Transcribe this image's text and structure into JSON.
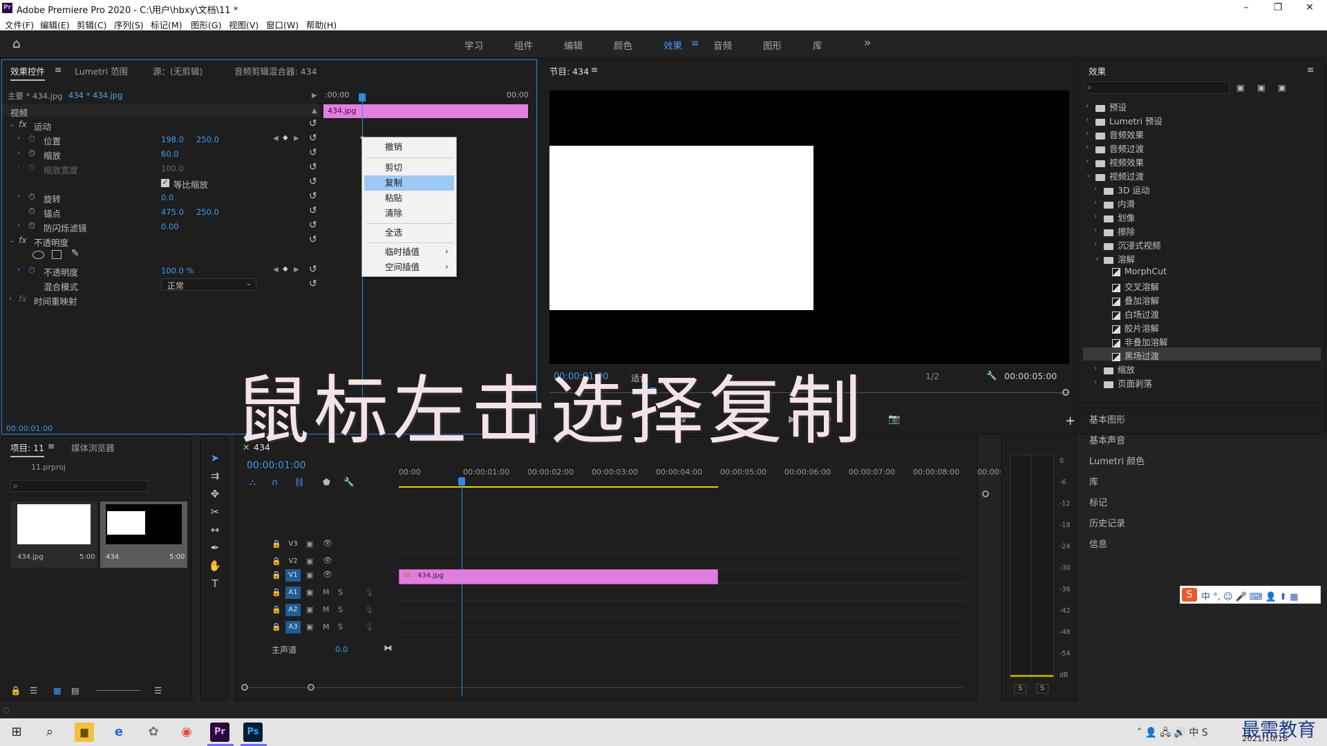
{
  "window": {
    "title": "Adobe Premiere Pro 2020 - C:\\用户\\hbxy\\文档\\11 *",
    "min": "–",
    "max": "❐",
    "close": "✕"
  },
  "menu": [
    "文件(F)",
    "编辑(E)",
    "剪辑(C)",
    "序列(S)",
    "标记(M)",
    "图形(G)",
    "视图(V)",
    "窗口(W)",
    "帮助(H)"
  ],
  "workspaces": {
    "items": [
      "学习",
      "组件",
      "编辑",
      "颜色",
      "效果",
      "音频",
      "图形",
      "库"
    ],
    "active": "效果",
    "more": "»",
    "menu_icon": "≡"
  },
  "effect_controls": {
    "tabs": [
      "效果控件",
      "Lumetri 范围",
      "源：(无剪辑)",
      "音频剪辑混合器: 434"
    ],
    "master": "主要 * 434.jpg",
    "clip": "434 * 434.jpg",
    "ruler_start": ":00:00",
    "ruler_end": "00:00",
    "clip_label": "434.jpg",
    "video_label": "视频",
    "motion": "运动",
    "position": "位置",
    "position_x": "198.0",
    "position_y": "250.0",
    "scale": "缩放",
    "scale_v": "60.0",
    "scale_width": "缩放宽度",
    "scale_width_v": "100.0",
    "uniform": "等比缩放",
    "rotation": "旋转",
    "rotation_v": "0.0",
    "anchor": "锚点",
    "anchor_x": "475.0",
    "anchor_y": "250.0",
    "flicker": "防闪烁滤镜",
    "flicker_v": "0.00",
    "opacity_group": "不透明度",
    "opacity": "不透明度",
    "opacity_v": "100.0 %",
    "blend": "混合模式",
    "blend_v": "正常",
    "remap": "时间重映射",
    "timecode": "00:00:01:00"
  },
  "context_menu": {
    "items": [
      "撤销",
      "剪切",
      "复制",
      "粘贴",
      "清除",
      "全选",
      "临时插值",
      "空间插值"
    ],
    "selected": "复制"
  },
  "program": {
    "title": "节目: 434",
    "timecode": "00:00:01:00",
    "fit": "适合",
    "quality": "1/2",
    "duration": "00:00:05:00"
  },
  "effects_panel": {
    "title": "效果",
    "tree": [
      {
        "label": "预设",
        "type": "folder",
        "level": 0,
        "open": false
      },
      {
        "label": "Lumetri 预设",
        "type": "folder",
        "level": 0,
        "open": false
      },
      {
        "label": "音频效果",
        "type": "folder",
        "level": 0,
        "open": false
      },
      {
        "label": "音频过渡",
        "type": "folder",
        "level": 0,
        "open": false
      },
      {
        "label": "视频效果",
        "type": "folder",
        "level": 0,
        "open": false
      },
      {
        "label": "视频过渡",
        "type": "folder",
        "level": 0,
        "open": true
      },
      {
        "label": "3D 运动",
        "type": "folder",
        "level": 1,
        "open": false
      },
      {
        "label": "内滑",
        "type": "folder",
        "level": 1,
        "open": false
      },
      {
        "label": "划像",
        "type": "folder",
        "level": 1,
        "open": false
      },
      {
        "label": "擦除",
        "type": "folder",
        "level": 1,
        "open": false
      },
      {
        "label": "沉浸式视频",
        "type": "folder",
        "level": 1,
        "open": false
      },
      {
        "label": "溶解",
        "type": "folder",
        "level": 1,
        "open": true
      },
      {
        "label": "MorphCut",
        "type": "fx",
        "level": 2
      },
      {
        "label": "交叉溶解",
        "type": "fx",
        "level": 2
      },
      {
        "label": "叠加溶解",
        "type": "fx",
        "level": 2
      },
      {
        "label": "白场过渡",
        "type": "fx",
        "level": 2
      },
      {
        "label": "胶片溶解",
        "type": "fx",
        "level": 2
      },
      {
        "label": "非叠加溶解",
        "type": "fx",
        "level": 2
      },
      {
        "label": "黑场过渡",
        "type": "fx",
        "level": 2,
        "selected": true
      },
      {
        "label": "缩放",
        "type": "folder",
        "level": 1,
        "open": false
      },
      {
        "label": "页面剥落",
        "type": "folder",
        "level": 1,
        "open": false
      }
    ],
    "links": [
      "基本图形",
      "基本声音",
      "Lumetri 颜色",
      "库",
      "标记",
      "历史记录",
      "信息"
    ]
  },
  "project": {
    "tabs": [
      "项目: 11",
      "媒体浏览器"
    ],
    "file": "11.prproj",
    "items": [
      {
        "name": "434.jpg",
        "dur": "5:00"
      },
      {
        "name": "434",
        "dur": "5:00"
      }
    ]
  },
  "timeline": {
    "tab": "434",
    "timecode": "00:00:01:00",
    "ruler": [
      "00:00",
      "00:00:01:00",
      "00:00:02:00",
      "00:00:03:00",
      "00:00:04:00",
      "00:00:05:00",
      "00:00:06:00",
      "00:00:07:00",
      "00:00:08:00",
      "00:00:0"
    ],
    "tracks": [
      "V3",
      "V2",
      "V1",
      "A1",
      "A2",
      "A3"
    ],
    "master": "主声道",
    "master_v": "0.0",
    "clip": "434.jpg"
  },
  "meter": {
    "ticks": [
      "0",
      "-6",
      "-12",
      "-18",
      "-24",
      "-30",
      "-36",
      "-42",
      "-48",
      "-54",
      "dB"
    ],
    "solo": [
      "S",
      "S"
    ]
  },
  "overlay": "鼠标左击选择复制",
  "taskbar": {
    "date": "2021/10/18",
    "ime": "中 °, ☺ 🎤 ⌨ 👤 ⬆ ▦",
    "watermark": "最需教育"
  }
}
